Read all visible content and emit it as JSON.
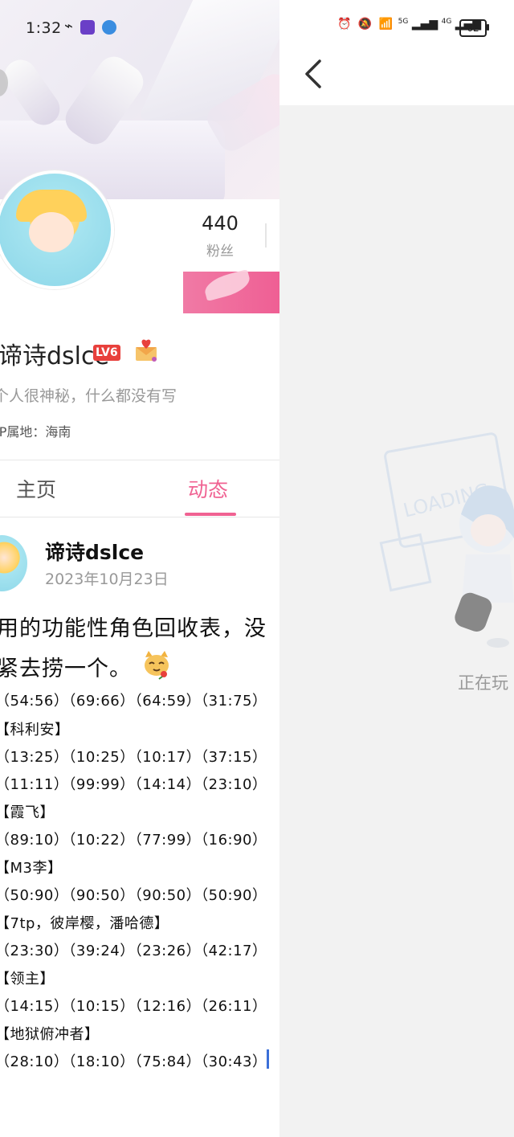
{
  "status_bar": {
    "time": "1:32",
    "battery": "62",
    "network_5g": "5G",
    "network_4g": "4G"
  },
  "profile": {
    "fans_count": "440",
    "fans_label": "粉丝",
    "username": "谛诗dslce",
    "level_badge": "LV6",
    "bio": "个人很神秘，什么都没有写",
    "ip_location": "IP属地：海南"
  },
  "tabs": [
    {
      "label": "主页",
      "active": false
    },
    {
      "label": "动态",
      "active": true
    }
  ],
  "post": {
    "author": "谛诗dslce",
    "date": "2023年10月23日",
    "line1": "用的功能性角色回收表，没",
    "line2": "紧去捞一个。",
    "rows": [
      "（54:56）（69:66）（64:59）（31:75）",
      "【科利安】",
      "（13:25）（10:25）（10:17）（37:15）",
      "（11:11）（99:99）（14:14）（23:10）",
      "【霞飞】",
      "（89:10）（10:22）（77:99）（16:90）",
      "【M3李】",
      "（50:90）（90:50）（90:50）（50:90）",
      "【7tp，彼岸樱，潘哈德】",
      "（23:30）（39:24）（23:26）（42:17）",
      "【领主】",
      "（14:15）（10:15）（12:16）（26:11）",
      "【地狱俯冲者】",
      "（28:10）（18:10）（75:84）（30:43）"
    ]
  },
  "loading": {
    "text": "正在玩",
    "art_text": "LOADING"
  },
  "colors": {
    "accent": "#f06292",
    "lv_badge": "#e8403c",
    "cursor": "#3b6fd8"
  }
}
